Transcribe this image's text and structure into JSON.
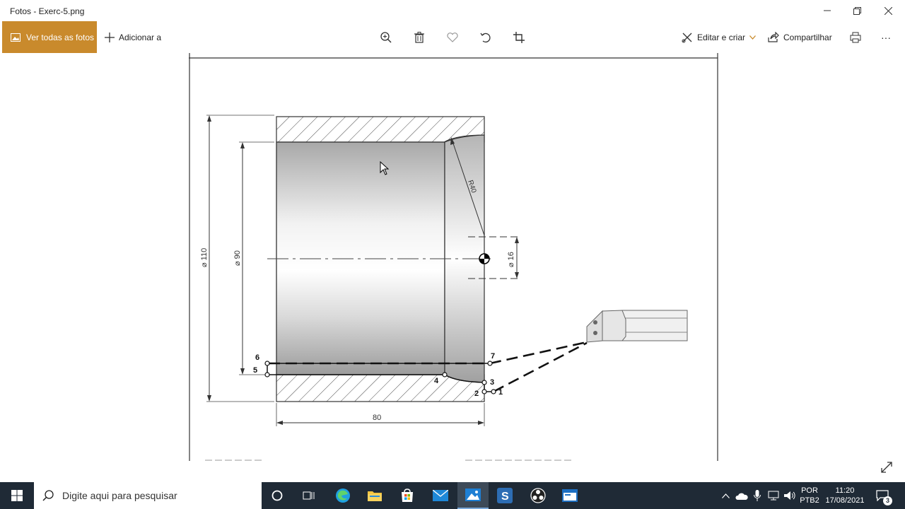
{
  "window": {
    "title": "Fotos - Exerc-5.png"
  },
  "toolbar": {
    "all_photos_label": "Ver todas as fotos",
    "add_to_label": "Adicionar a",
    "edit_create_label": "Editar e criar",
    "share_label": "Compartilhar",
    "more_label": "···"
  },
  "drawing": {
    "dim_d110": "⌀ 110",
    "dim_d90": "⌀ 90",
    "dim_d16": "⌀ 16",
    "dim_r40": "R40",
    "dim_80": "80",
    "points": [
      "1",
      "2",
      "3",
      "4",
      "5",
      "6",
      "7"
    ]
  },
  "taskbar": {
    "search_placeholder": "Digite aqui para pesquisar",
    "lang_top": "POR",
    "lang_bottom": "PTB2",
    "time": "11:20",
    "date": "17/08/2021",
    "notif_count": "3"
  },
  "colors": {
    "accent": "#c98a2c",
    "taskbar": "#1f2a36"
  }
}
